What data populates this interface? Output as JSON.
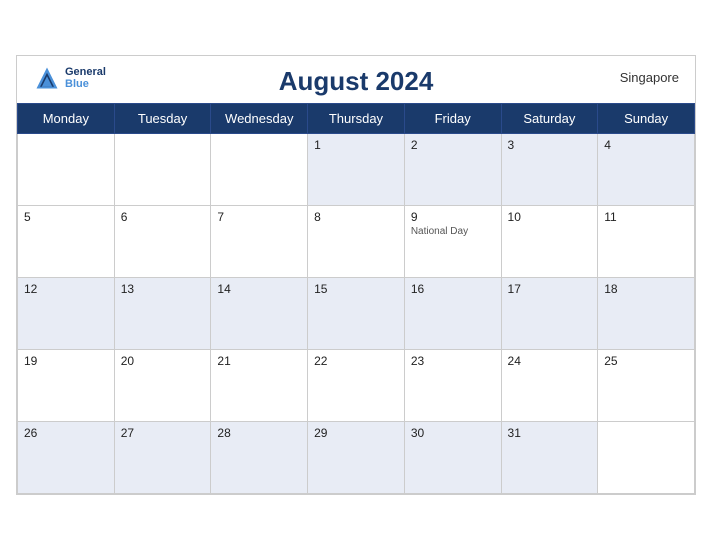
{
  "header": {
    "title": "August 2024",
    "country": "Singapore",
    "logo_general": "General",
    "logo_blue": "Blue"
  },
  "weekdays": [
    "Monday",
    "Tuesday",
    "Wednesday",
    "Thursday",
    "Friday",
    "Saturday",
    "Sunday"
  ],
  "rows": [
    [
      {
        "day": "",
        "empty": true
      },
      {
        "day": "",
        "empty": true
      },
      {
        "day": "",
        "empty": true
      },
      {
        "day": "1"
      },
      {
        "day": "2"
      },
      {
        "day": "3"
      },
      {
        "day": "4"
      }
    ],
    [
      {
        "day": "5"
      },
      {
        "day": "6"
      },
      {
        "day": "7"
      },
      {
        "day": "8"
      },
      {
        "day": "9",
        "holiday": "National Day"
      },
      {
        "day": "10"
      },
      {
        "day": "11"
      }
    ],
    [
      {
        "day": "12"
      },
      {
        "day": "13"
      },
      {
        "day": "14"
      },
      {
        "day": "15"
      },
      {
        "day": "16"
      },
      {
        "day": "17"
      },
      {
        "day": "18"
      }
    ],
    [
      {
        "day": "19"
      },
      {
        "day": "20"
      },
      {
        "day": "21"
      },
      {
        "day": "22"
      },
      {
        "day": "23"
      },
      {
        "day": "24"
      },
      {
        "day": "25"
      }
    ],
    [
      {
        "day": "26"
      },
      {
        "day": "27"
      },
      {
        "day": "28"
      },
      {
        "day": "29"
      },
      {
        "day": "30"
      },
      {
        "day": "31"
      },
      {
        "day": "",
        "empty": true
      }
    ]
  ]
}
